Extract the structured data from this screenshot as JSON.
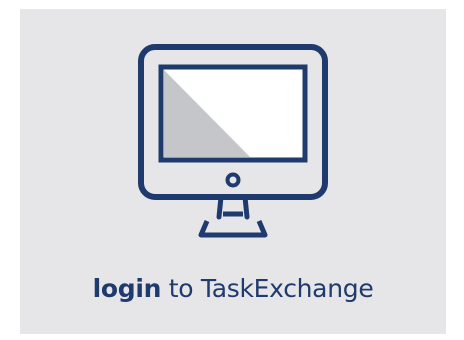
{
  "tile": {
    "caption_link": "login",
    "caption_rest": " to TaskExchange",
    "icon": "monitor-icon"
  },
  "colors": {
    "background": "#e6e6e9",
    "accent": "#1f3a6d",
    "screen_shade": "#c4c6ca",
    "screen_fill": "#ffffff"
  }
}
